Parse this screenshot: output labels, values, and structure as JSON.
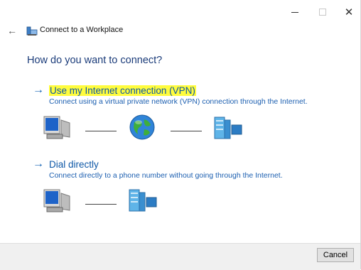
{
  "window": {
    "title": "Connect to a Workplace",
    "minimize_glyph": "–",
    "close_glyph": "✕",
    "back_glyph": "←"
  },
  "heading": "How do you want to connect?",
  "options": [
    {
      "arrow": "→",
      "title": "Use my Internet connection (VPN)",
      "description": "Connect using a virtual private network (VPN) connection through the Internet.",
      "highlighted": true,
      "diagram": [
        "computer-icon",
        "globe-icon",
        "server-icon"
      ]
    },
    {
      "arrow": "→",
      "title": "Dial directly",
      "description": "Connect directly to a phone number without going through the Internet.",
      "highlighted": false,
      "diagram": [
        "computer-icon",
        "server-icon"
      ]
    }
  ],
  "footer": {
    "cancel_label": "Cancel"
  },
  "colors": {
    "link": "#0d57a6",
    "heading": "#1b3c7a",
    "highlight": "#fffc3d",
    "footer_bg": "#f0f0f0"
  }
}
